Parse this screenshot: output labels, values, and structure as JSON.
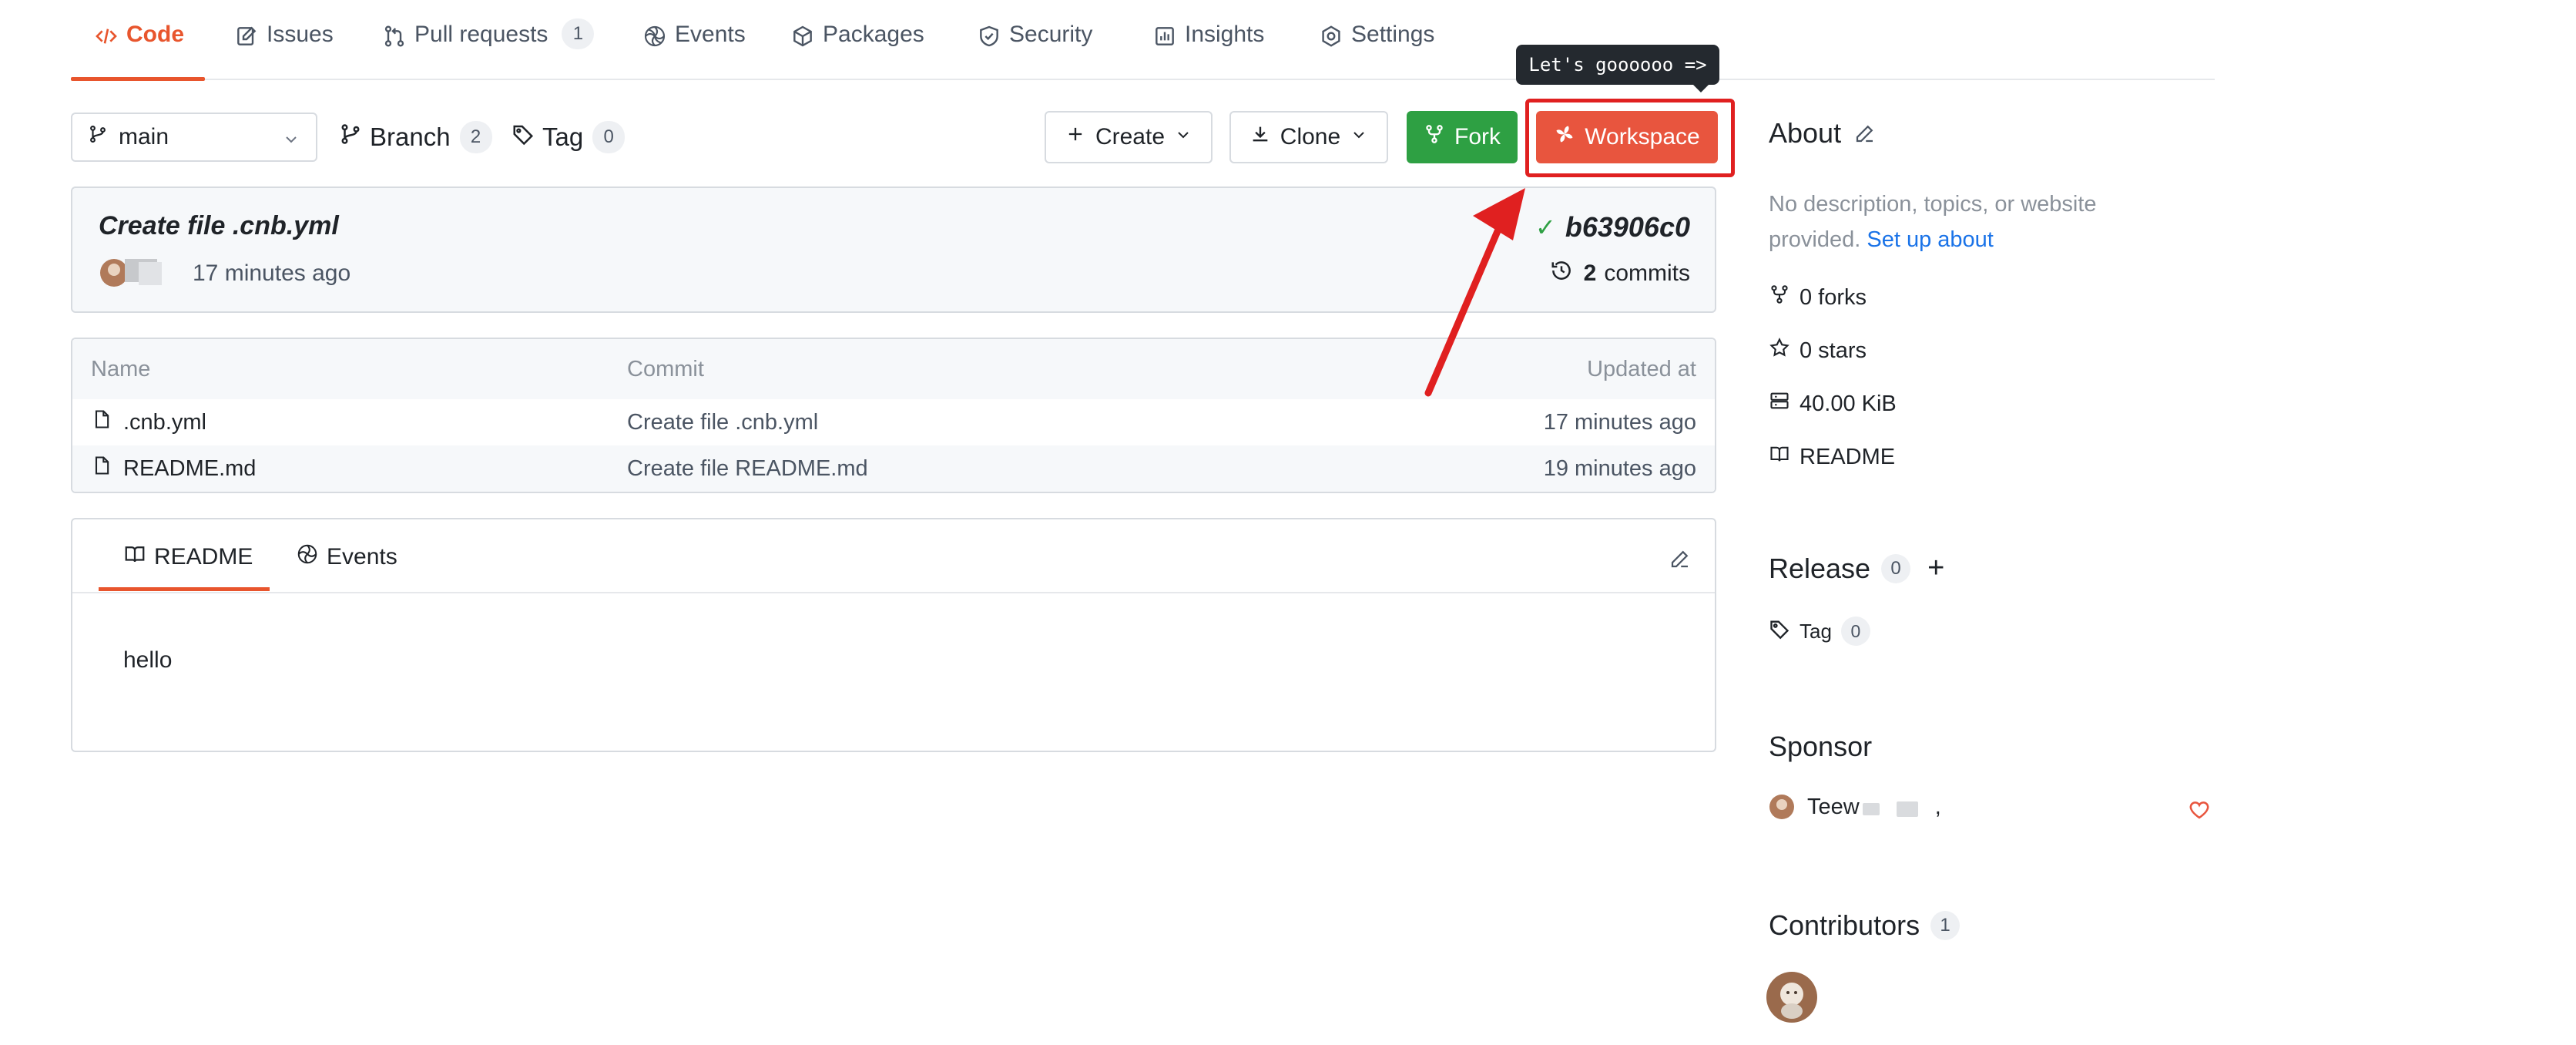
{
  "tabs": [
    {
      "label": "Code",
      "icon": "code-icon",
      "active": true
    },
    {
      "label": "Issues",
      "icon": "issue-icon"
    },
    {
      "label": "Pull requests",
      "icon": "pull-request-icon",
      "count": "1"
    },
    {
      "label": "Events",
      "icon": "events-icon"
    },
    {
      "label": "Packages",
      "icon": "package-icon"
    },
    {
      "label": "Security",
      "icon": "shield-icon"
    },
    {
      "label": "Insights",
      "icon": "insights-icon"
    },
    {
      "label": "Settings",
      "icon": "gear-icon"
    }
  ],
  "toolbar": {
    "branch": "main",
    "branch_label": "Branch",
    "branch_count": "2",
    "tag_label": "Tag",
    "tag_count": "0",
    "create_label": "Create",
    "clone_label": "Clone",
    "fork_label": "Fork",
    "workspace_label": "Workspace",
    "tooltip": "Let's goooooo =>"
  },
  "commit": {
    "title": "Create file .cnb.yml",
    "time": "17 minutes ago",
    "hash": "b63906c0",
    "count": "2",
    "count_label": "commits"
  },
  "files": {
    "headers": {
      "name": "Name",
      "commit": "Commit",
      "updated": "Updated at"
    },
    "rows": [
      {
        "name": ".cnb.yml",
        "commit": "Create file .cnb.yml",
        "updated": "17 minutes ago"
      },
      {
        "name": "README.md",
        "commit": "Create file README.md",
        "updated": "19 minutes ago"
      }
    ]
  },
  "readme": {
    "tab_readme": "README",
    "tab_events": "Events",
    "body": "hello"
  },
  "sidebar": {
    "about_title": "About",
    "about_text": "No description, topics, or website provided.",
    "setup_link": "Set up about",
    "forks": "0 forks",
    "stars": "0 stars",
    "size": "40.00 KiB",
    "readme": "README",
    "release_title": "Release",
    "release_count": "0",
    "tag_label": "Tag",
    "tag_count": "0",
    "sponsor_title": "Sponsor",
    "sponsor_name": "Teew",
    "sponsor_suffix": ",",
    "contributors_title": "Contributors",
    "contributors_count": "1"
  },
  "colors": {
    "accent": "#e8552d",
    "fork_green": "#2ea043",
    "workspace_red": "#e8553e",
    "annotation_red": "#e02020",
    "link_blue": "#1a73e8"
  }
}
